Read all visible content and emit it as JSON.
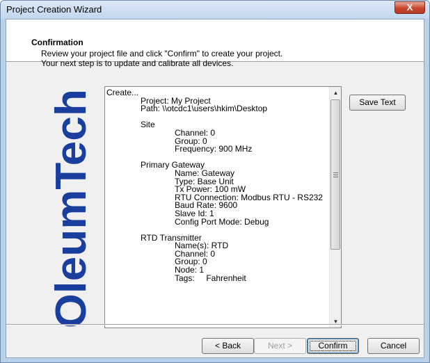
{
  "window": {
    "title": "Project Creation Wizard"
  },
  "header": {
    "title": "Confirmation",
    "line1": "Review your project file and click \"Confirm\" to create your project.",
    "line2": "Your next step is to update and calibrate all devices."
  },
  "logo": {
    "text": "OleumTech",
    "color": "#1a3e9e"
  },
  "summary_lines": [
    "Create...",
    "Project: My Project",
    "Path: \\\\otcdc1\\users\\hkim\\Desktop",
    "",
    "Site",
    "Channel: 0",
    "Group: 0",
    "Frequency: 900 MHz",
    "",
    "Primary Gateway",
    "Name: Gateway",
    "Type: Base Unit",
    "Tx Power: 100 mW",
    "RTU Connection: Modbus RTU - RS232",
    "Baud Rate: 9600",
    "Slave Id: 1",
    "Config Port Mode: Debug",
    "",
    "RTD Transmitter",
    "Name(s): RTD",
    "Channel: 0",
    "Group: 0",
    "Node: 1",
    "Tags:     Fahrenheit"
  ],
  "buttons": {
    "save_text": "Save Text",
    "back": "< Back",
    "next": "Next >",
    "confirm": "Confirm",
    "cancel": "Cancel",
    "close": "X"
  },
  "icons": {
    "close": "close-icon",
    "scroll_up": "scroll-up-arrow-icon",
    "scroll_down": "scroll-down-arrow-icon"
  }
}
